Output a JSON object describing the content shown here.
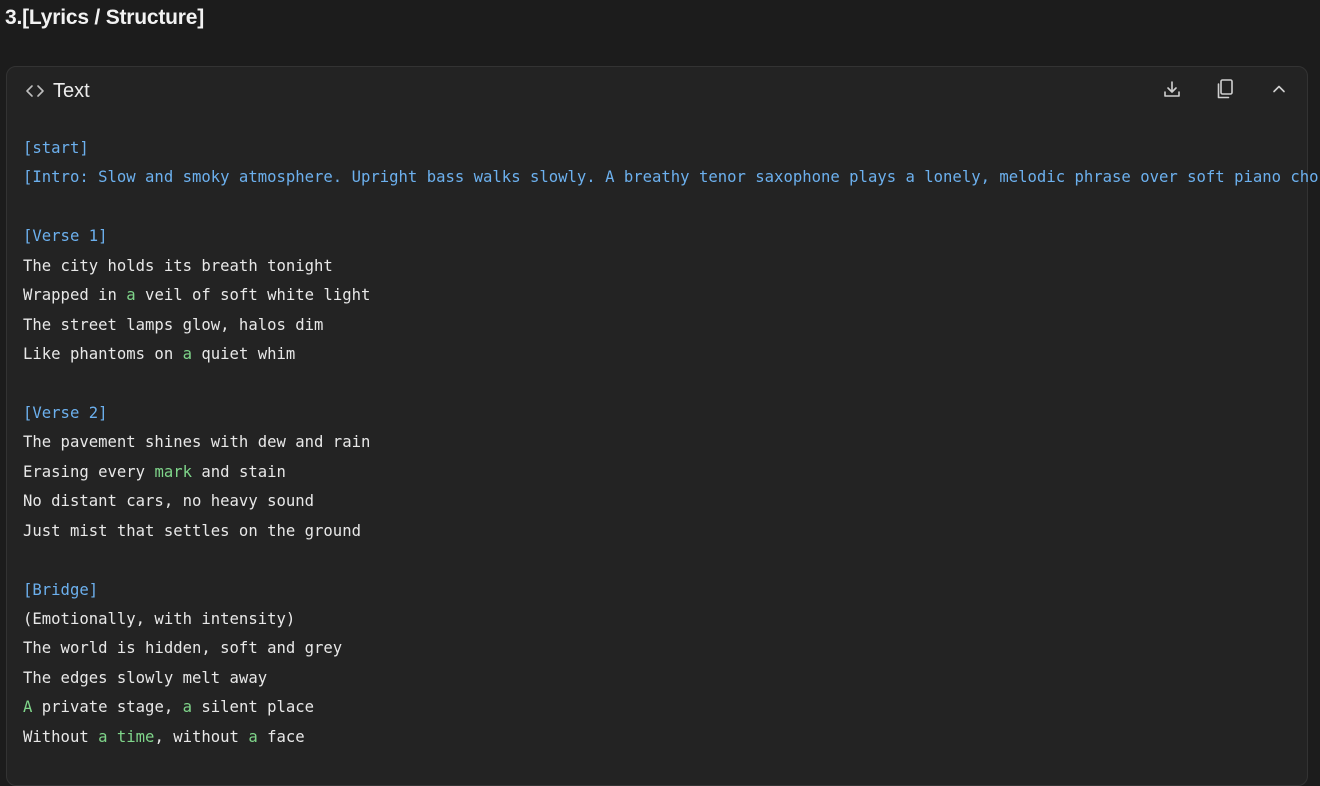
{
  "page": {
    "section_heading": "3.[Lyrics / Structure]"
  },
  "panel": {
    "title": "Text",
    "title_icon": "code-icon",
    "actions": [
      {
        "name": "download-icon"
      },
      {
        "name": "copy-icon"
      },
      {
        "name": "chevron-up-icon"
      }
    ]
  },
  "lyrics": {
    "lines": [
      [
        {
          "t": "[start]",
          "c": "tag"
        }
      ],
      [
        {
          "t": "[Intro: Slow and smoky atmosphere. Upright bass walks slowly. A breathy tenor saxophone plays a lonely, melodic phrase over soft piano chords.]",
          "c": "tag"
        }
      ],
      [],
      [
        {
          "t": "[Verse 1]",
          "c": "tag"
        }
      ],
      [
        {
          "t": "The city holds its breath tonight",
          "c": ""
        }
      ],
      [
        {
          "t": "Wrapped in ",
          "c": ""
        },
        {
          "t": "a",
          "c": "kw"
        },
        {
          "t": " veil of soft white light",
          "c": ""
        }
      ],
      [
        {
          "t": "The street lamps glow, halos dim",
          "c": ""
        }
      ],
      [
        {
          "t": "Like phantoms on ",
          "c": ""
        },
        {
          "t": "a",
          "c": "kw"
        },
        {
          "t": " quiet whim",
          "c": ""
        }
      ],
      [],
      [
        {
          "t": "[Verse 2]",
          "c": "tag"
        }
      ],
      [
        {
          "t": "The pavement shines with dew and rain",
          "c": ""
        }
      ],
      [
        {
          "t": "Erasing every ",
          "c": ""
        },
        {
          "t": "mark",
          "c": "kw"
        },
        {
          "t": " and stain",
          "c": ""
        }
      ],
      [
        {
          "t": "No distant cars, no heavy sound",
          "c": ""
        }
      ],
      [
        {
          "t": "Just mist that settles on the ground",
          "c": ""
        }
      ],
      [],
      [
        {
          "t": "[Bridge]",
          "c": "tag"
        }
      ],
      [
        {
          "t": "(Emotionally, with intensity)",
          "c": ""
        }
      ],
      [
        {
          "t": "The world is hidden, soft and grey",
          "c": ""
        }
      ],
      [
        {
          "t": "The edges slowly melt away",
          "c": ""
        }
      ],
      [
        {
          "t": "A",
          "c": "kw"
        },
        {
          "t": " private stage, ",
          "c": ""
        },
        {
          "t": "a",
          "c": "kw"
        },
        {
          "t": " silent place",
          "c": ""
        }
      ],
      [
        {
          "t": "Without ",
          "c": ""
        },
        {
          "t": "a",
          "c": "kw"
        },
        {
          "t": " ",
          "c": ""
        },
        {
          "t": "time",
          "c": "kw"
        },
        {
          "t": ", without ",
          "c": ""
        },
        {
          "t": "a",
          "c": "kw"
        },
        {
          "t": " face",
          "c": ""
        }
      ]
    ]
  },
  "colors": {
    "background": "#1c1c1c",
    "panel": "#232323",
    "tag": "#6cb0ee",
    "keyword": "#7fd58a",
    "text": "#e8e8e8"
  }
}
